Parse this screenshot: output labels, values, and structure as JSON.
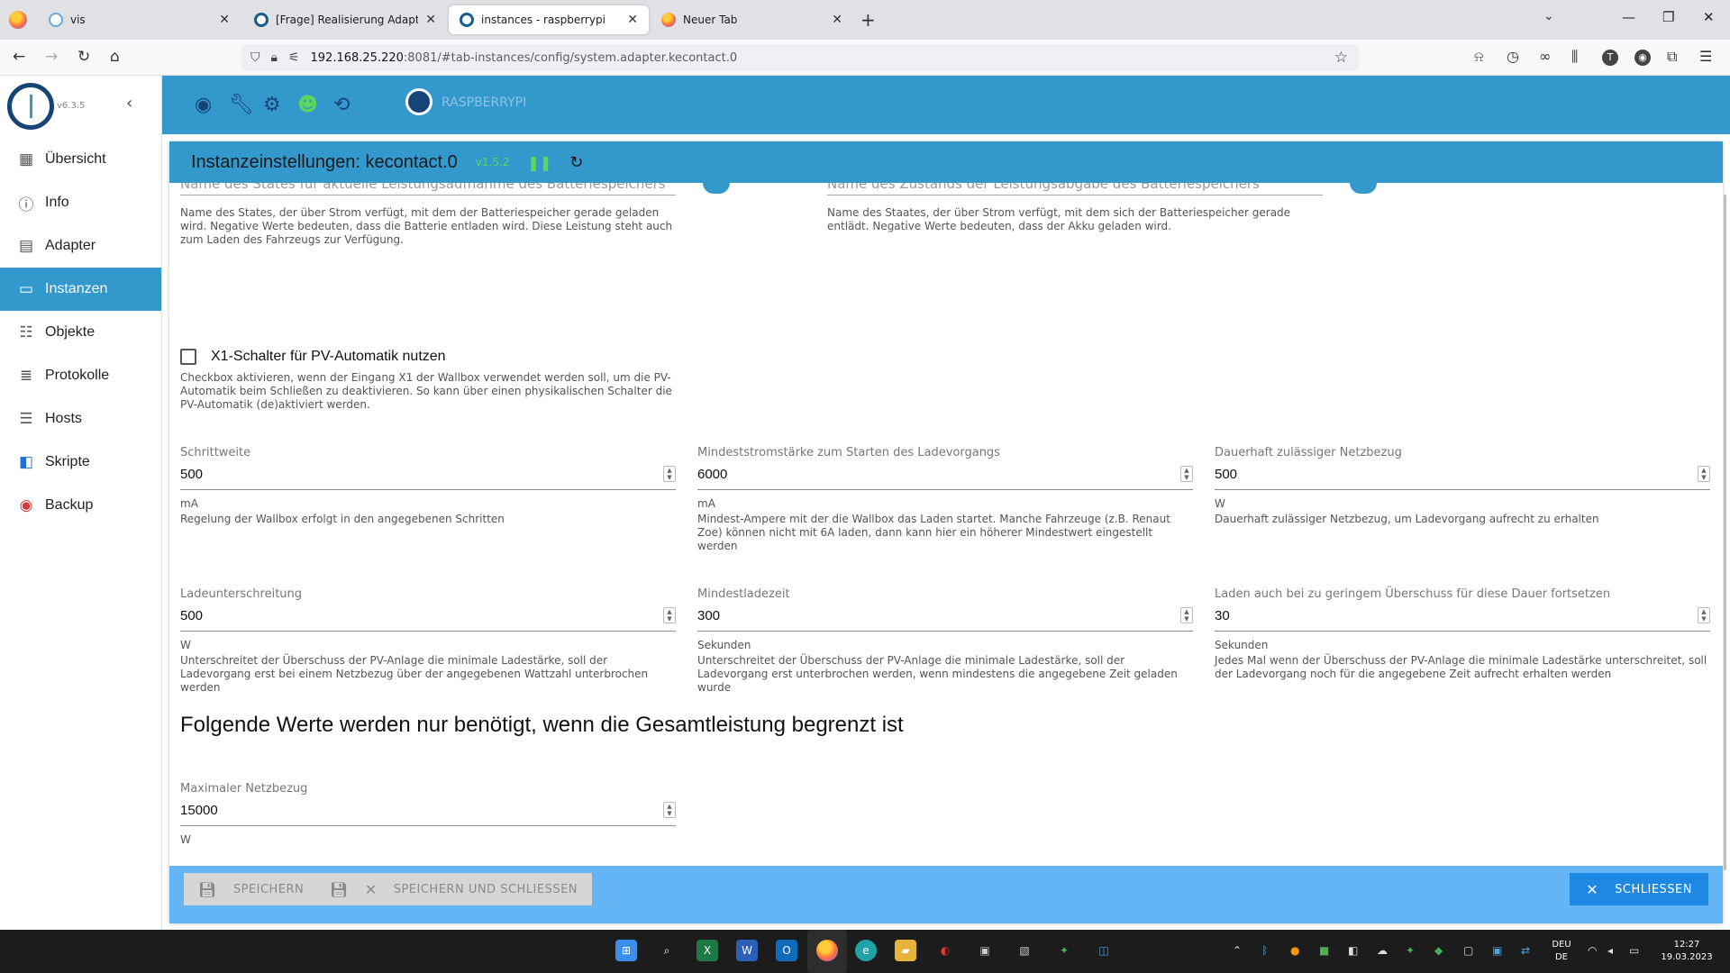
{
  "browser": {
    "tabs": [
      {
        "title": "vis"
      },
      {
        "title": "[Frage] Realisierung Adapter UD"
      },
      {
        "title": "instances - raspberrypi"
      },
      {
        "title": "Neuer Tab"
      }
    ],
    "url_host": "192.168.25.220",
    "url_rest": ":8081/#tab-instances/config/system.adapter.kecontact.0",
    "profile_initial": "T"
  },
  "app": {
    "version": "v6.3.5",
    "host_name": "RASPBERRYPI",
    "colors": {
      "primary": "#3399cc",
      "dark": "#164477",
      "footer": "#64b5f6",
      "close_button": "#1e88e5"
    },
    "menu": [
      {
        "label": "Übersicht",
        "icon": "grid-icon"
      },
      {
        "label": "Info",
        "icon": "info-icon"
      },
      {
        "label": "Adapter",
        "icon": "store-icon"
      },
      {
        "label": "Instanzen",
        "icon": "instances-icon",
        "active": true
      },
      {
        "label": "Objekte",
        "icon": "list-icon"
      },
      {
        "label": "Protokolle",
        "icon": "log-icon"
      },
      {
        "label": "Hosts",
        "icon": "hosts-icon"
      },
      {
        "label": "Skripte",
        "icon": "js-icon"
      },
      {
        "label": "Backup",
        "icon": "backup-icon"
      }
    ]
  },
  "dialog": {
    "title": "Instanzeinstellungen: kecontact.0",
    "version": "v1.5.2",
    "top_left": {
      "label": "Name des States für aktuelle Leistungsaufnahme des Batteriespeichers",
      "help": "Name des States, der über Strom verfügt, mit dem der Batteriespeicher gerade geladen wird. Negative Werte bedeuten, dass die Batterie entladen wird. Diese Leistung steht auch zum Laden des Fahrzeugs zur Verfügung."
    },
    "top_right": {
      "label": "Name des Zustands der Leistungsabgabe des Batteriespeichers",
      "help": "Name des Staates, der über Strom verfügt, mit dem sich der Batteriespeicher gerade entlädt. Negative Werte bedeuten, dass der Akku geladen wird."
    },
    "x1_checkbox": {
      "label": "X1-Schalter für PV-Automatik nutzen",
      "help": "Checkbox aktivieren, wenn der Eingang X1 der Wallbox verwendet werden soll, um die PV-Automatik beim Schließen zu deaktivieren. So kann über einen physikalischen Schalter die PV-Automatik (de)aktiviert werden.",
      "checked": false
    },
    "fields": [
      {
        "label": "Schrittweite",
        "value": "500",
        "unit": "mA",
        "help": "Regelung der Wallbox erfolgt in den angegebenen Schritten"
      },
      {
        "label": "Mindeststromstärke zum Starten des Ladevorgangs",
        "value": "6000",
        "unit": "mA",
        "help": "Mindest-Ampere mit der die Wallbox das Laden startet. Manche Fahrzeuge (z.B. Renaut Zoe) können nicht mit 6A laden, dann kann hier ein höherer Mindestwert eingestellt werden"
      },
      {
        "label": "Dauerhaft zulässiger Netzbezug",
        "value": "500",
        "unit": "W",
        "help": "Dauerhaft zulässiger Netzbezug, um Ladevorgang aufrecht zu erhalten"
      },
      {
        "label": "Ladeunterschreitung",
        "value": "500",
        "unit": "W",
        "help": "Unterschreitet der Überschuss der PV-Anlage die minimale Ladestärke, soll der Ladevorgang erst bei einem Netzbezug über der angegebenen Wattzahl unterbrochen werden"
      },
      {
        "label": "Mindestladezeit",
        "value": "300",
        "unit": "Sekunden",
        "help": "Unterschreitet der Überschuss der PV-Anlage die minimale Ladestärke, soll der Ladevorgang erst unterbrochen werden, wenn mindestens die angegebene Zeit geladen wurde"
      },
      {
        "label": "Laden auch bei zu geringem Überschuss für diese Dauer fortsetzen",
        "value": "30",
        "unit": "Sekunden",
        "help": "Jedes Mal wenn der Überschuss der PV-Anlage die minimale Ladestärke unterschreitet, soll der Ladevorgang noch für die angegebene Zeit aufrecht erhalten werden"
      }
    ],
    "section_title": "Folgende Werte werden nur benötigt, wenn die Gesamtleistung begrenzt ist",
    "max_grid": {
      "label": "Maximaler Netzbezug",
      "value": "15000",
      "unit": "W"
    },
    "buttons": {
      "save": "SPEICHERN",
      "save_close": "SPEICHERN UND SCHLIESSEN",
      "close": "SCHLIESSEN"
    }
  },
  "taskbar": {
    "lang_1": "DEU",
    "lang_2": "DE",
    "time": "12:27",
    "date": "19.03.2023"
  }
}
